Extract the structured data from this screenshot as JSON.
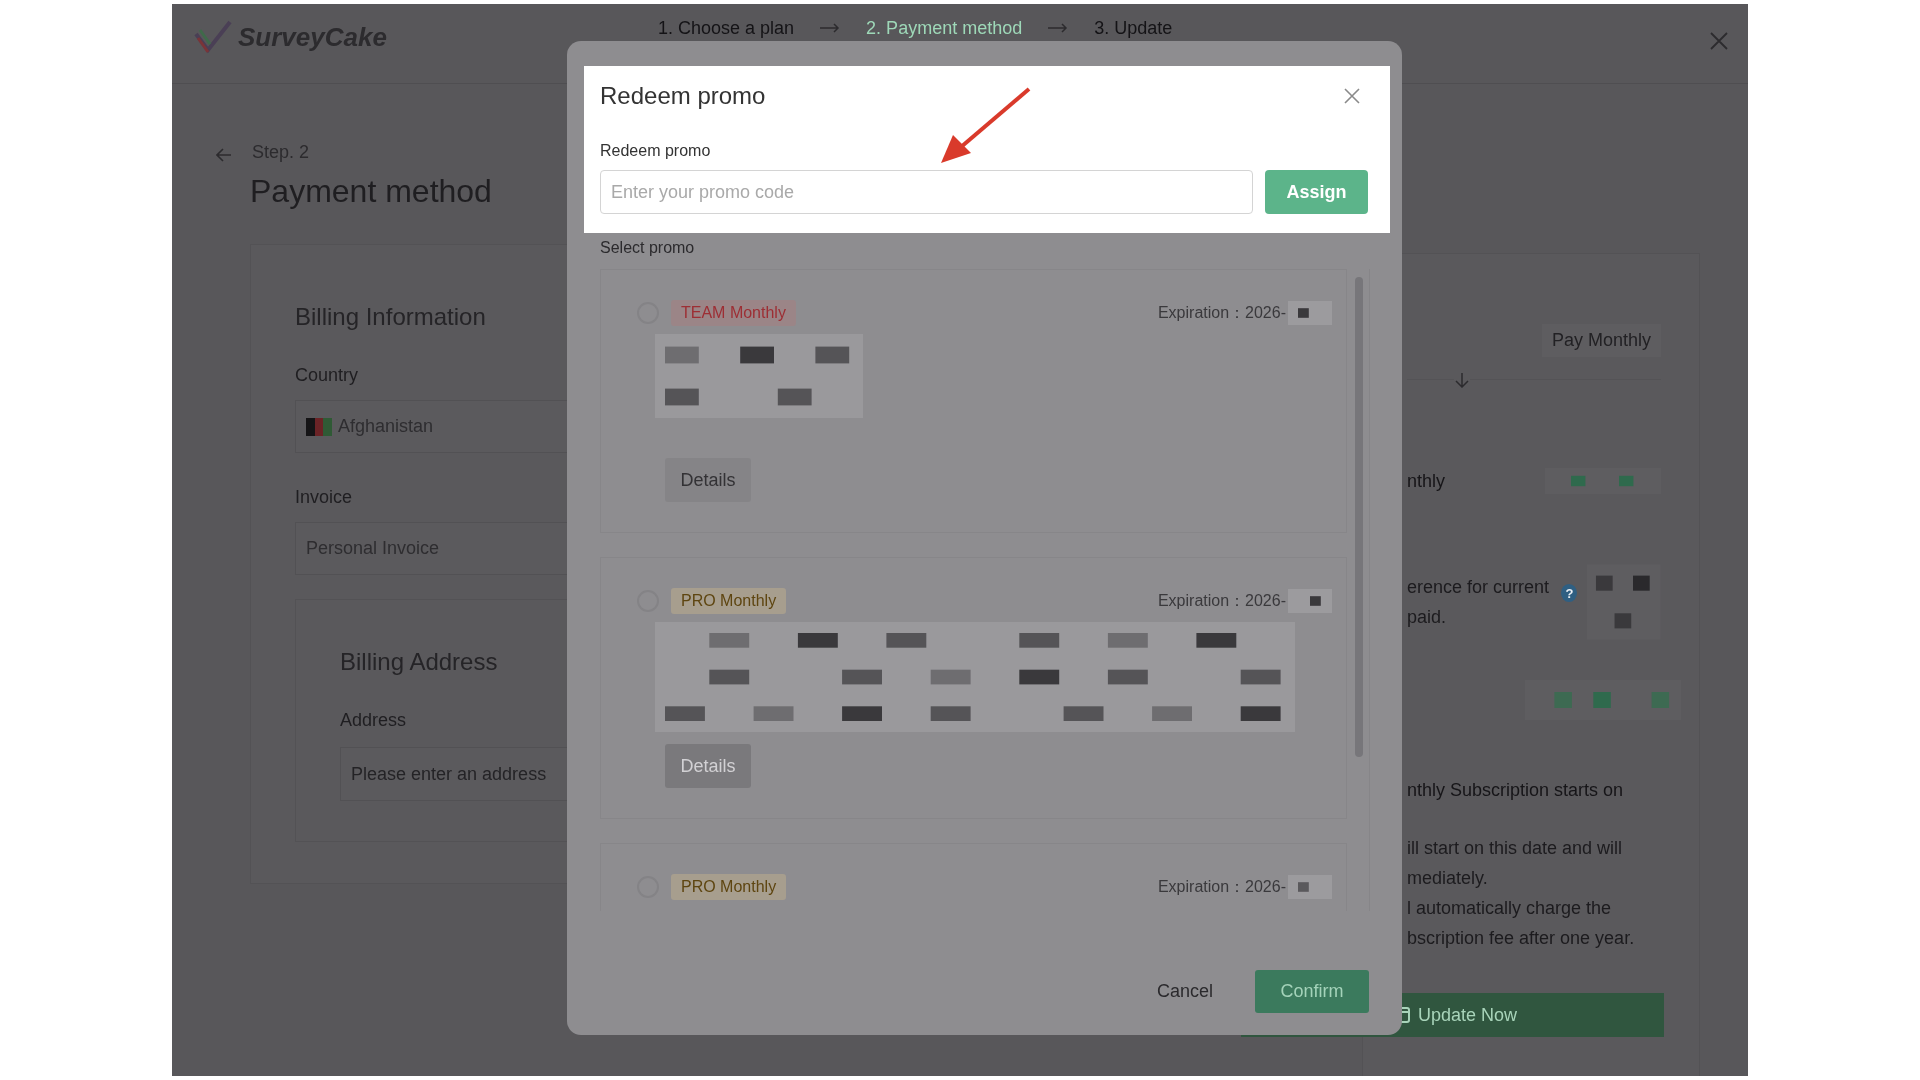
{
  "header": {
    "logo": "SurveyCake",
    "steps": [
      {
        "label": "1. Choose a plan",
        "selected": false
      },
      {
        "label": "2. Payment method",
        "selected": true
      },
      {
        "label": "3. Update",
        "selected": false
      }
    ]
  },
  "page": {
    "step": "Step. 2",
    "title": "Payment method"
  },
  "billing": {
    "heading": "Billing Information",
    "country_label": "Country",
    "country": "Afghanistan",
    "invoice_label": "Invoice",
    "invoice": "Personal Invoice"
  },
  "address": {
    "heading": "Billing Address",
    "label": "Address",
    "placeholder": "Please enter an address"
  },
  "summary": {
    "plan_badge": "Pay Monthly",
    "plan_row": "nthly",
    "note_lines": [
      "erence for current",
      "paid."
    ],
    "help_icon": "?",
    "start_line": "nthly Subscription starts on",
    "info_lines": [
      "ill start on this date and will",
      "mediately.",
      "l automatically charge the",
      "bscription fee after one year."
    ],
    "button": "Update Now"
  },
  "modal": {
    "title": "Redeem promo",
    "field_label": "Redeem promo",
    "placeholder": "Enter your promo code",
    "assign": "Assign",
    "select_label": "Select promo",
    "promos": [
      {
        "kind": "team",
        "tag": "TEAM Monthly",
        "expiration": "Expiration：2026-",
        "selected": false,
        "redacted": true,
        "details": "Details",
        "details_disabled": false
      },
      {
        "kind": "pro",
        "tag": "PRO Monthly",
        "expiration": "Expiration：2026-",
        "selected": false,
        "redacted": true,
        "details": "Details",
        "details_disabled": true
      },
      {
        "kind": "pro",
        "tag": "PRO Monthly",
        "expiration": "Expiration：2026-",
        "selected": false,
        "redacted": false
      }
    ],
    "cancel": "Cancel",
    "confirm": "Confirm"
  }
}
